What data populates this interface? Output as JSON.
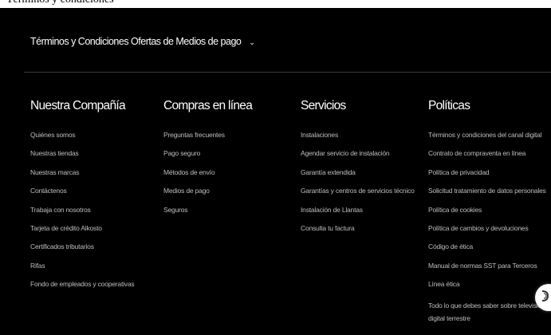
{
  "top_clip_text": "Términos y condiciones",
  "terms": {
    "label": "Términos y Condiciones Ofertas de Medios de pago",
    "chevron": "⌄"
  },
  "columns": [
    {
      "title": "Nuestra Compañía",
      "items": [
        "Quiénes somos",
        "Nuestras tiendas",
        "Nuestras marcas",
        "Contáctenos",
        "Trabaja con nosotros",
        "Tarjeta de crédito Alkosto",
        "Certificados tributarios",
        "Rifas",
        "Fondo de empleados y cooperativas"
      ]
    },
    {
      "title": "Compras en línea",
      "items": [
        "Preguntas frecuentes",
        "Pago seguro",
        "Métodos de envío",
        "Medios de pago",
        "Seguros"
      ]
    },
    {
      "title": "Servicios",
      "items": [
        "Instalaciones",
        "Agendar servicio de instalación",
        "Garantía extendida",
        "Garantías y centros de servicios técnico",
        "Instalación de Llantas",
        "Consulta tu factura"
      ]
    },
    {
      "title": "Políticas",
      "items": [
        "Términos y condiciones del canal digital",
        "Contrato de compraventa en línea",
        "Política de privacidad",
        "Solicitud tratamiento de datos personales",
        "Política de cookies",
        "Política de cambios y devoluciones",
        "Código de ética",
        "Manual de normas SST para Terceros",
        "Línea ética",
        "Todo lo que debes saber sobre televisión digital terrestre"
      ]
    }
  ],
  "chat_icon": "chat-support-icon",
  "colors": {
    "background": "#000000",
    "heading": "#ffffff",
    "link": "#bdbdbd",
    "divider": "#3a3a3a"
  }
}
